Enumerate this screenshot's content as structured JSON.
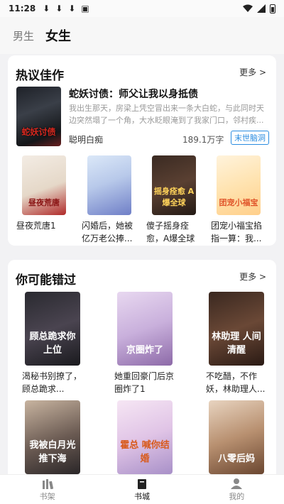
{
  "status_bar": {
    "time": "11:28"
  },
  "top_tabs": [
    {
      "label": "男生",
      "active": false
    },
    {
      "label": "女生",
      "active": true
    }
  ],
  "hot": {
    "title": "热议佳作",
    "more": "更多 >",
    "featured": {
      "cover_text": "蛇妖讨债",
      "title": "蛇妖讨债：师父让我以身抵债",
      "desc": "我出生那天，房梁上凭空冒出来一条大白蛇，与此同时天边突然塌了一个角，大水眨眼淹到了我家门口，邻村疾...",
      "author": "聪明白痴",
      "words": "189.1万字",
      "tag": "末世脑洞"
    },
    "books": [
      {
        "name": "昼夜荒唐1",
        "cover_text": "昼夜荒唐"
      },
      {
        "name": "闪婚后，她被亿万老公捧...",
        "cover_text": ""
      },
      {
        "name": "傻子摇身痊愈，A爆全球",
        "cover_text": "摇身痊愈 A爆全球"
      },
      {
        "name": "团宠小福宝掐指一算：我...",
        "cover_text": "团宠小福宝"
      }
    ]
  },
  "miss": {
    "title": "你可能错过",
    "more": "更多 >",
    "books": [
      {
        "name": "渴秘书别撩了，顾总跪求...",
        "cover_text": "顾总跪求你上位"
      },
      {
        "name": "她重回豪门后京圈炸了1",
        "cover_text": "京圈炸了"
      },
      {
        "name": "不吃醋，不作妖，林助理人...",
        "cover_text": "林助理 人间清醒"
      },
      {
        "name": "",
        "cover_text": "我被白月光推下海"
      },
      {
        "name": "",
        "cover_text": "霍总 喊你结婚"
      },
      {
        "name": "",
        "cover_text": "八零后妈"
      }
    ]
  },
  "bottom_nav": [
    {
      "label": "书架",
      "active": false
    },
    {
      "label": "书城",
      "active": true
    },
    {
      "label": "我的",
      "active": false
    }
  ]
}
